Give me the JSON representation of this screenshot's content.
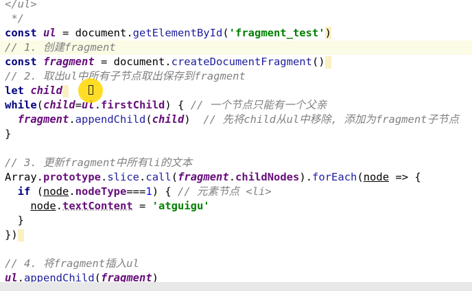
{
  "code": {
    "l0_ul_close": "</ul>",
    "l1_comment_end": " */",
    "l2_const": "const ",
    "l2_var": "ul",
    "l2_eq": " = document.",
    "l2_fn": "getElementById",
    "l2_open": "(",
    "l2_str": "'fragment_test'",
    "l2_close": ")",
    "l3_comment": "// 1. 创建fragment",
    "l4_const": "const ",
    "l4_var": "fragment",
    "l4_eq": " = document.",
    "l4_fn": "createDocumentFragment",
    "l4_paren": "()",
    "l5_comment": "// 2. 取出ul中所有子节点取出保存到fragment",
    "l6_let": "let ",
    "l6_var": "child",
    "l7_while": "while",
    "l7_open": "(",
    "l7_child": "child",
    "l7_eq": "=",
    "l7_ul": "ul",
    "l7_dot": ".",
    "l7_prop": "firstChild",
    "l7_rest": ") { ",
    "l7_comment": "// 一个节点只能有一个父亲",
    "l8_indent": "  ",
    "l8_fragment": "fragment",
    "l8_dot": ".",
    "l8_fn": "appendChild",
    "l8_open": "(",
    "l8_child": "child",
    "l8_close": ")  ",
    "l8_comment": "// 先将child从ul中移除, 添加为fragment子节点",
    "l9_brace": "}",
    "l11_comment": "// 3. 更新fragment中所有li的文本",
    "l12_array": "Array.",
    "l12_proto": "prototype",
    "l12_dot1": ".",
    "l12_slice": "slice",
    "l12_dot2": ".",
    "l12_call": "call",
    "l12_open": "(",
    "l12_fragment": "fragment",
    "l12_dot3": ".",
    "l12_childnodes": "childNodes",
    "l12_close": ").",
    "l12_foreach": "forEach",
    "l12_open2": "(",
    "l12_node": "node",
    "l12_arrow": " => {",
    "l13_indent": "  ",
    "l13_if": "if",
    "l13_open": " (",
    "l13_node": "node",
    "l13_dot": ".",
    "l13_nodetype": "nodeType",
    "l13_eq": "===",
    "l13_num": "1",
    "l13_rest": ") { ",
    "l13_comment": "// 元素节点 <li>",
    "l14_indent": "    ",
    "l14_node": "node",
    "l14_dot": ".",
    "l14_prop": "textContent",
    "l14_eq": " = ",
    "l14_str": "'atguigu'",
    "l15_brace": "  }",
    "l16_close": "})",
    "l18_comment": "// 4. 将fragment插入ul",
    "l19_ul": "ul",
    "l19_dot": ".",
    "l19_fn": "appendChild",
    "l19_open": "(",
    "l19_fragment": "fragment",
    "l19_close": ")"
  },
  "colors": {
    "keyword": "#000080",
    "variable": "#660e7a",
    "string": "#008000",
    "comment": "#808080",
    "number": "#0000ff",
    "cursor_highlight": "#ffd700"
  }
}
